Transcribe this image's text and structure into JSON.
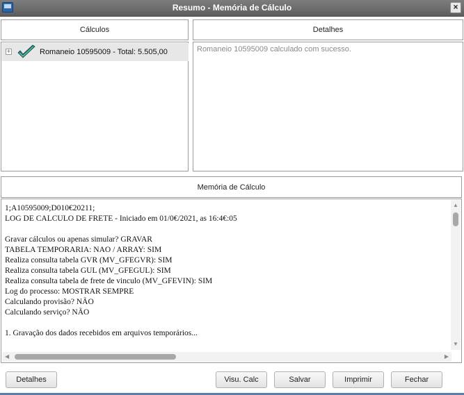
{
  "window": {
    "title": "Resumo - Memória de Cálculo",
    "close_label": "×"
  },
  "calculos_panel": {
    "header": "Cálculos",
    "items": [
      {
        "expander": "+",
        "status_icon": "check-icon",
        "label": "Romaneio 10595009 - Total: 5.505,00"
      }
    ]
  },
  "detalhes_panel": {
    "header": "Detalhes",
    "text": "Romaneio 10595009 calculado com sucesso."
  },
  "memoria_panel": {
    "header": "Memória de Cálculo",
    "content": "1;A10595009;D010€20211;\nLOG DE CALCULO DE FRETE - Iniciado em 01/0€/2021, as 16:4€:05\n\nGravar cálculos ou apenas simular? GRAVAR\nTABELA TEMPORARIA: NAO / ARRAY: SIM\nRealiza consulta tabela GVR (MV_GFEGVR): SIM\nRealiza consulta tabela GUL (MV_GFEGUL): SIM\nRealiza consulta tabela de frete de vinculo (MV_GFEVIN): SIM\nLog do processo: MOSTRAR SEMPRE\nCalculando provisão? NÃO\nCalculando serviço? NÃO\n\n1. Gravação dos dados recebidos em arquivos temporários..."
  },
  "buttons": {
    "detalhes": "Detalhes",
    "visu_calc": "Visu. Calc",
    "salvar": "Salvar",
    "imprimir": "Imprimir",
    "fechar": "Fechar"
  },
  "colors": {
    "titlebar": "#6e6e6e",
    "check": "#1f7a6a",
    "selected_row": "#e7e7e7"
  }
}
